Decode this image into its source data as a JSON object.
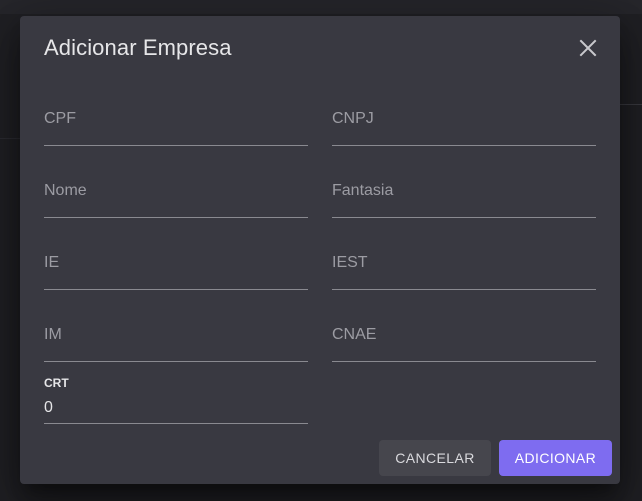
{
  "dialog": {
    "title": "Adicionar Empresa",
    "close_icon": "close-icon"
  },
  "fields": {
    "cpf": {
      "placeholder": "CPF"
    },
    "cnpj": {
      "placeholder": "CNPJ"
    },
    "nome": {
      "placeholder": "Nome"
    },
    "fantasia": {
      "placeholder": "Fantasia"
    },
    "ie": {
      "placeholder": "IE"
    },
    "iest": {
      "placeholder": "IEST"
    },
    "im": {
      "placeholder": "IM"
    },
    "cnae": {
      "placeholder": "CNAE"
    },
    "crt": {
      "label": "CRT",
      "value": "0"
    }
  },
  "actions": {
    "cancel_label": "CANCELAR",
    "add_label": "ADICIONAR"
  },
  "colors": {
    "dialog_bg": "#393941",
    "primary": "#7e6cf0",
    "secondary_button": "#46464d"
  }
}
